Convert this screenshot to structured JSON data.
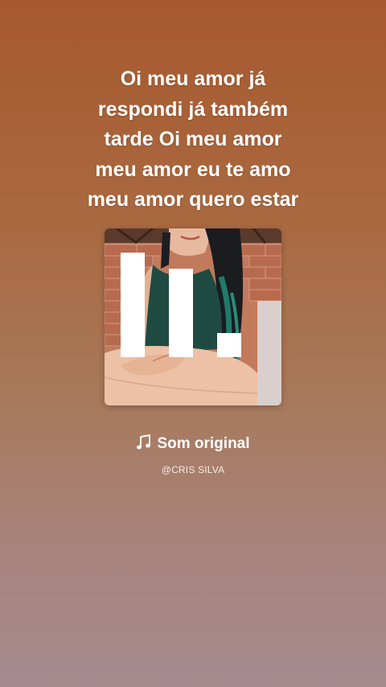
{
  "lyrics": {
    "lines": [
      "Oi meu amor já",
      "respondi já também",
      "tarde Oi meu amor",
      "meu amor eu te amo",
      "meu amor quero estar"
    ]
  },
  "sound": {
    "icon": "music-note-icon",
    "title": "Som original",
    "author": "@CRIS SILVA"
  },
  "cover": {
    "watermark_icon": "app-logo-icon"
  },
  "colors": {
    "gradient_top": "#a8582e",
    "gradient_bottom": "#a58a8f",
    "text": "#ffffff"
  }
}
